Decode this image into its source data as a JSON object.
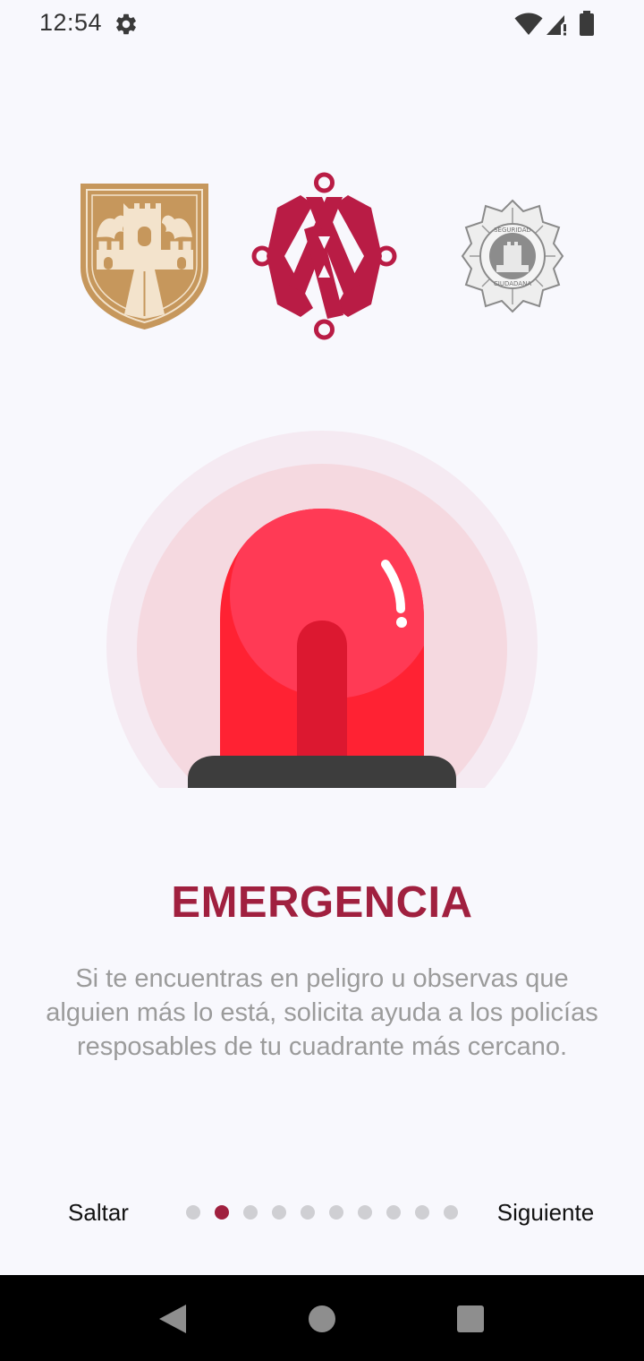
{
  "status_bar": {
    "time": "12:54",
    "icons": [
      "settings-gear-icon",
      "wifi-icon",
      "signal-icon",
      "battery-icon"
    ]
  },
  "logos": [
    "cdmx-coat-of-arms-logo",
    "cdmx-knot-logo",
    "seguridad-ciudadana-badge-logo"
  ],
  "badge_text": {
    "top": "SEGURIDAD",
    "bottom": "CIUDADANA"
  },
  "illustration": "emergency-siren",
  "content": {
    "title": "EMERGENCIA",
    "description": "Si te encuentras en peligro u observas que alguien más lo está, solicita ayuda a los policías resposables de tu cuadrante más cercano."
  },
  "navigation": {
    "skip_label": "Saltar",
    "next_label": "Siguiente",
    "page_count": 10,
    "active_page": 2
  },
  "colors": {
    "background": "#f8f8fd",
    "accent": "#a0203f",
    "description_text": "#9b9b9b",
    "inactive_dot": "#cfcfd3",
    "logo_gold": "#c6975c",
    "logo_crimson": "#b91c45",
    "siren_red": "#ff2233"
  },
  "system_nav": {
    "buttons": [
      "back-icon",
      "home-icon",
      "recents-icon"
    ]
  }
}
